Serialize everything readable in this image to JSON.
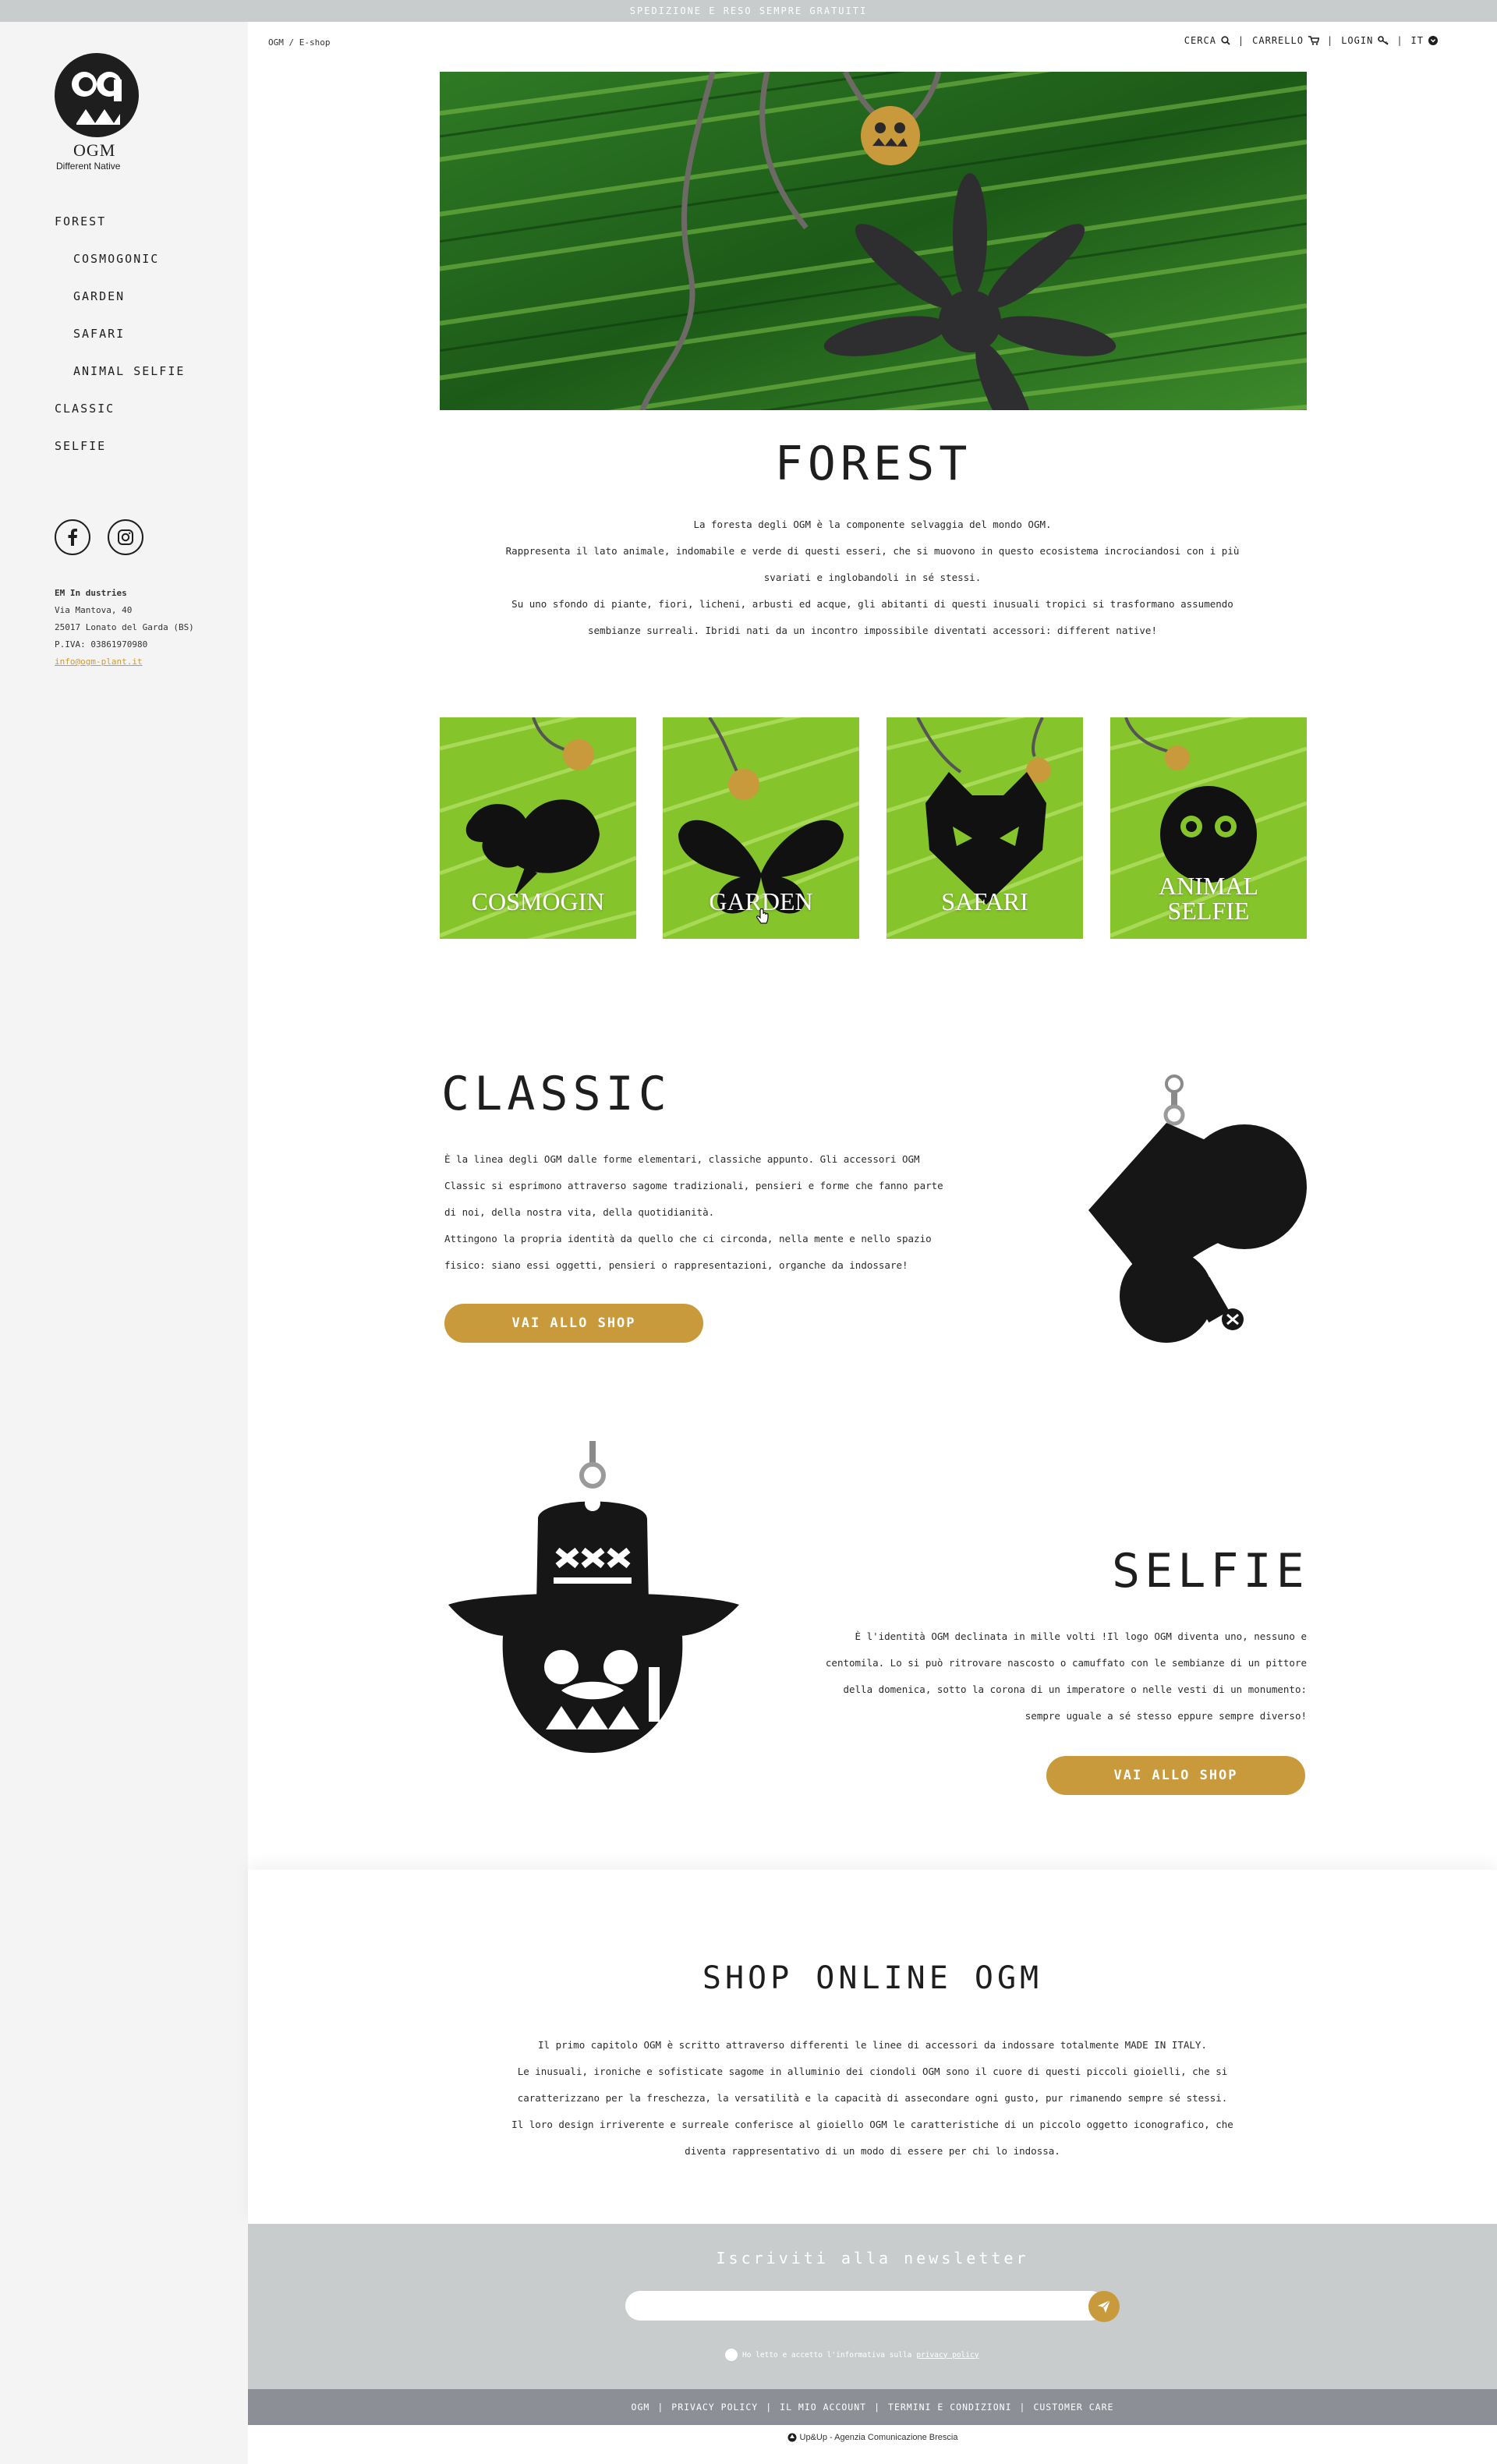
{
  "topbar": {
    "text": "SPEDIZIONE E RESO SEMPRE GRATUITI"
  },
  "brand": {
    "name": "OGM",
    "tagline": "Different Native"
  },
  "sidebar": {
    "nav": [
      {
        "label": "FOREST",
        "sub": false
      },
      {
        "label": "COSMOGONIC",
        "sub": true
      },
      {
        "label": "GARDEN",
        "sub": true
      },
      {
        "label": "SAFARI",
        "sub": true
      },
      {
        "label": "ANIMAL SELFIE",
        "sub": true
      },
      {
        "label": "CLASSIC",
        "sub": false
      },
      {
        "label": "SELFIE",
        "sub": false
      }
    ],
    "company": {
      "name": "EM In dustries",
      "address1": "Via Mantova, 40",
      "address2": "25017 Lonato del Garda (BS)",
      "vat": "P.IVA: 03861970980",
      "email": "info@ogm-plant.it"
    }
  },
  "header": {
    "breadcrumb": "OGM / E-shop",
    "search": "CERCA",
    "cart": "CARRELLO",
    "login": "LOGIN",
    "lang": "IT"
  },
  "forest": {
    "title": "FOREST",
    "lines": [
      "La foresta degli OGM è la componente selvaggia del mondo OGM.",
      "Rappresenta il lato animale, indomabile e verde di questi esseri, che si muovono in questo ecosistema incrociandosi con i più",
      "svariati e inglobandoli in sé stessi.",
      "Su uno sfondo di piante, fiori, licheni, arbusti ed acque, gli abitanti di questi inusuali tropici si trasformano assumendo",
      "sembianze surreali. Ibridi nati da un incontro impossibile diventati accessori: different native!"
    ]
  },
  "tiles": [
    {
      "label1": "COSMOGIN",
      "label2": ""
    },
    {
      "label1": "GARDEN",
      "label2": ""
    },
    {
      "label1": "SAFARI",
      "label2": ""
    },
    {
      "label1": "ANIMAL",
      "label2": "SELFIE"
    }
  ],
  "classic": {
    "title": "CLASSIC",
    "lines": [
      "È la linea degli OGM dalle forme elementari, classiche appunto. Gli accessori OGM",
      "Classic si esprimono attraverso sagome tradizionali, pensieri e forme che fanno parte",
      "di noi, della nostra vita, della quotidianità.",
      "Attingono la propria identità da quello che ci circonda, nella mente e nello spazio",
      "fisico: siano essi oggetti, pensieri o rappresentazioni, organche da indossare!"
    ],
    "button": "VAI ALLO SHOP"
  },
  "selfie": {
    "title": "SELFIE",
    "lines": [
      "È l'identità OGM declinata in mille volti !Il logo OGM diventa uno, nessuno e",
      "centomila. Lo si può ritrovare nascosto o camuffato con le sembianze di un pittore",
      "della domenica, sotto la corona di un imperatore o nelle vesti di un monumento:",
      "sempre uguale a sé stesso eppure sempre diverso!"
    ],
    "button": "VAI ALLO SHOP"
  },
  "shop_online": {
    "title": "SHOP ONLINE OGM",
    "lines": [
      "Il primo capitolo OGM è scritto attraverso differenti le linee di accessori da indossare totalmente MADE IN ITALY.",
      "Le inusuali, ironiche e sofisticate sagome in alluminio dei ciondoli OGM sono il cuore di questi piccoli gioielli, che si",
      "caratterizzano per la freschezza, la versatilità e la capacità di assecondare ogni gusto, pur rimanendo sempre sé stessi.",
      "Il loro design irriverente e surreale conferisce al gioiello OGM le caratteristiche di un piccolo oggetto iconografico, che",
      "diventa rappresentativo di un modo di essere per chi lo indossa."
    ]
  },
  "newsletter": {
    "title": "Iscriviti alla newsletter",
    "placeholder": "",
    "consent": "Ho letto e accetto l'informativa sulla",
    "consent_link": "privacy policy"
  },
  "footer": {
    "links": [
      "OGM",
      "PRIVACY POLICY",
      "IL MIO ACCOUNT",
      "TERMINI E CONDIZIONI",
      "CUSTOMER CARE"
    ],
    "credit": "Up&Up - Agenzia Comunicazione Brescia"
  },
  "colors": {
    "gold": "#c99a3b",
    "sidebar": "#f4f4f4",
    "band": "#c9cccd",
    "footer": "#8c9096",
    "leaf": "#7dbd2a"
  }
}
